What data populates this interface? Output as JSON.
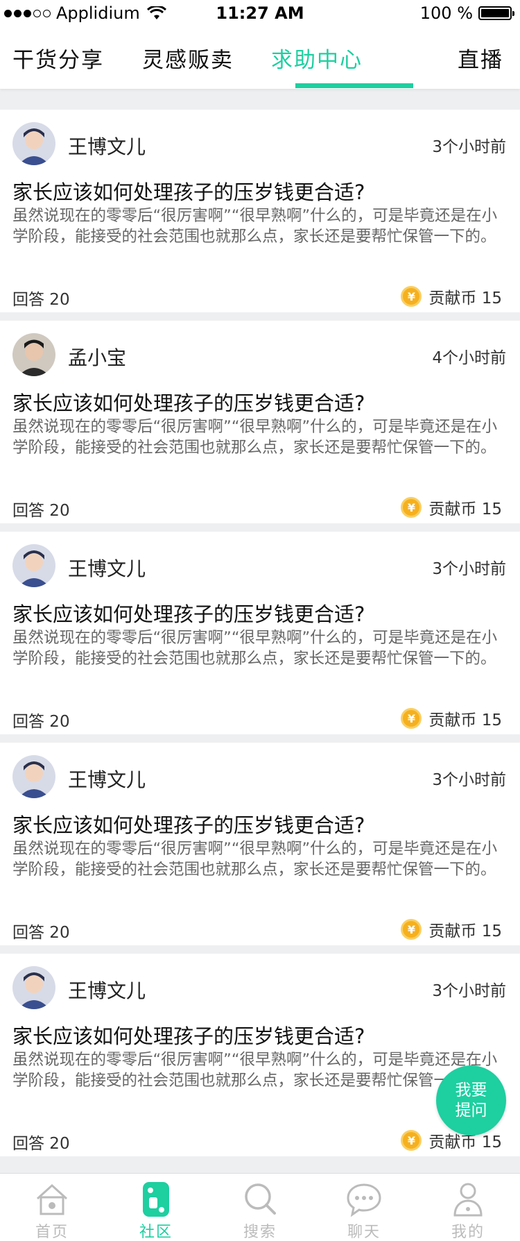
{
  "status_bar": {
    "carrier": "Applidium",
    "time": "11:27 AM",
    "battery": "100 %"
  },
  "top_tabs": [
    {
      "label": "干货分享",
      "active": false
    },
    {
      "label": "灵感贩卖",
      "active": false
    },
    {
      "label": "求助中心",
      "active": true
    },
    {
      "label": "直播",
      "active": false
    }
  ],
  "posts": [
    {
      "author": "王博文儿",
      "time_ago": "3个小时前",
      "title": "家长应该如何处理孩子的压岁钱更合适?",
      "body": "虽然说现在的零零后“很厉害啊”“很早熟啊”什么的，可是毕竟还是在小学阶段，能接受的社会范围也就那么点，家长还是要帮忙保管一下的。",
      "answers": "回答 20",
      "reward": "贡献币 15",
      "avatar_color": "#3a4f8f"
    },
    {
      "author": "孟小宝",
      "time_ago": "4个小时前",
      "title": "家长应该如何处理孩子的压岁钱更合适?",
      "body": "虽然说现在的零零后“很厉害啊”“很早熟啊”什么的，可是毕竟还是在小学阶段，能接受的社会范围也就那么点，家长还是要帮忙保管一下的。",
      "answers": "回答 20",
      "reward": "贡献币 15",
      "avatar_color": "#2b2b2b"
    },
    {
      "author": "王博文儿",
      "time_ago": "3个小时前",
      "title": "家长应该如何处理孩子的压岁钱更合适?",
      "body": "虽然说现在的零零后“很厉害啊”“很早熟啊”什么的，可是毕竟还是在小学阶段，能接受的社会范围也就那么点，家长还是要帮忙保管一下的。",
      "answers": "回答 20",
      "reward": "贡献币 15",
      "avatar_color": "#3a4f8f"
    },
    {
      "author": "王博文儿",
      "time_ago": "3个小时前",
      "title": "家长应该如何处理孩子的压岁钱更合适?",
      "body": "虽然说现在的零零后“很厉害啊”“很早熟啊”什么的，可是毕竟还是在小学阶段，能接受的社会范围也就那么点，家长还是要帮忙保管一下的。",
      "answers": "回答 20",
      "reward": "贡献币 15",
      "avatar_color": "#3a4f8f"
    },
    {
      "author": "王博文儿",
      "time_ago": "3个小时前",
      "title": "家长应该如何处理孩子的压岁钱更合适?",
      "body": "虽然说现在的零零后“很厉害啊”“很早熟啊”什么的，可是毕竟还是在小学阶段，能接受的社会范围也就那么点，家长还是要帮忙保管一下的。",
      "answers": "回答 20",
      "reward": "贡献币 15",
      "avatar_color": "#3a4f8f"
    }
  ],
  "coin_symbol": "¥",
  "fab": {
    "line1": "我要",
    "line2": "提问"
  },
  "bottom_nav": [
    {
      "label": "首页",
      "icon": "home-icon",
      "active": false
    },
    {
      "label": "社区",
      "icon": "community-icon",
      "active": true
    },
    {
      "label": "搜索",
      "icon": "search-icon",
      "active": false
    },
    {
      "label": "聊天",
      "icon": "chat-icon",
      "active": false
    },
    {
      "label": "我的",
      "icon": "profile-icon",
      "active": false
    }
  ],
  "colors": {
    "accent": "#1ecfa0",
    "inactive_nav": "#bbbbbb",
    "coin": "#f6b01e",
    "background": "#eeeff0"
  }
}
